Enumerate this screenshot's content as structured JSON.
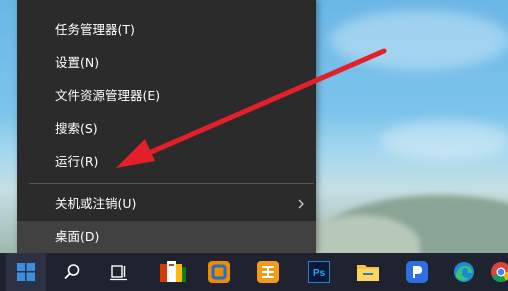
{
  "context_menu": {
    "items": [
      {
        "label": "任务管理器(T)"
      },
      {
        "label": "设置(N)"
      },
      {
        "label": "文件资源管理器(E)"
      },
      {
        "label": "搜索(S)"
      },
      {
        "label": "运行(R)"
      },
      {
        "label": "关机或注销(U)",
        "has_submenu": true
      },
      {
        "label": "桌面(D)",
        "selected": true
      }
    ]
  },
  "annotation": {
    "arrow_color": "#e3202a"
  },
  "taskbar": {
    "icons": [
      "windows-start-icon",
      "search-icon",
      "task-view-icon",
      "office-apps-icon",
      "orange-app-icon",
      "yellow-app-icon",
      "photoshop-icon",
      "file-explorer-icon",
      "blue-document-app-icon",
      "edge-browser-icon",
      "chrome-browser-icon"
    ],
    "photoshop_text": "Ps"
  },
  "colors": {
    "menu_bg": "#2b2b2b",
    "menu_text": "#ffffff",
    "taskbar_bg": "#1f2330",
    "accent": "#3a8fe0"
  }
}
